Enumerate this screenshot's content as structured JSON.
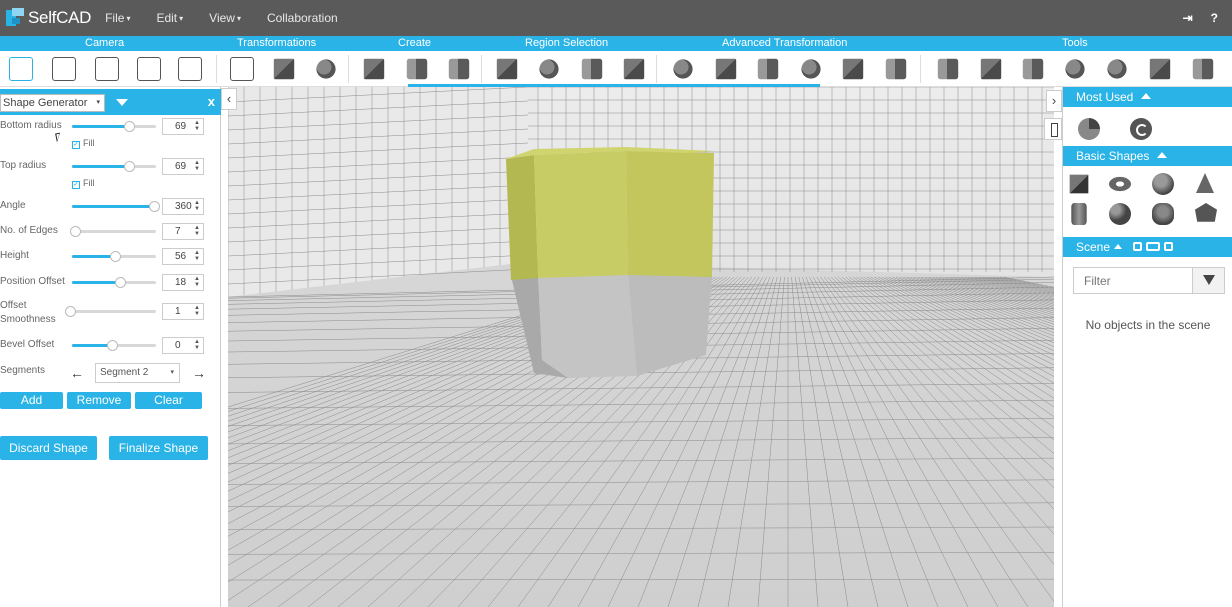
{
  "app": {
    "name": "SelfCAD"
  },
  "menu": [
    {
      "label": "File",
      "caret": "▾"
    },
    {
      "label": "Edit",
      "caret": "▾"
    },
    {
      "label": "View",
      "caret": "▾"
    },
    {
      "label": "Collaboration",
      "caret": ""
    }
  ],
  "topright": {
    "login_icon": "⇥",
    "help_icon": "?"
  },
  "categories": [
    "Camera",
    "Transformations",
    "Create",
    "Region Selection",
    "Advanced Transformation",
    "Tools"
  ],
  "left_panel": {
    "shape_select": "Shape Generator",
    "close": "x",
    "params": [
      {
        "label": "Bottom radius",
        "value": "69",
        "slider": 0.68
      },
      {
        "label": "Top radius",
        "value": "69",
        "slider": 0.68
      },
      {
        "label": "Angle",
        "value": "360",
        "slider": 1.0
      },
      {
        "label": "No. of Edges",
        "value": "7",
        "slider": 0.04
      },
      {
        "label": "Height",
        "value": "56",
        "slider": 0.52
      },
      {
        "label": "Position Offset",
        "value": "18",
        "slider": 0.58
      },
      {
        "label": "Offset Smoothness",
        "value": "1",
        "slider": 0.0
      },
      {
        "label": "Bevel Offset",
        "value": "0",
        "slider": 0.48
      }
    ],
    "fill_label": "Fill",
    "segments_label": "Segments",
    "segment_value": "Segment 2",
    "add": "Add",
    "remove": "Remove",
    "clear": "Clear",
    "discard": "Discard Shape",
    "finalize": "Finalize Shape"
  },
  "right_panel": {
    "most_used": "Most Used",
    "basic_shapes": "Basic Shapes",
    "scene": "Scene",
    "filter_placeholder": "Filter",
    "empty": "No objects in the scene"
  },
  "viewport": {
    "shape_top_color": "#c7cc64",
    "shape_bottom_color": "#c2c2c2",
    "grid_color": "#8a8a8a",
    "accent": "#29b3e6"
  }
}
